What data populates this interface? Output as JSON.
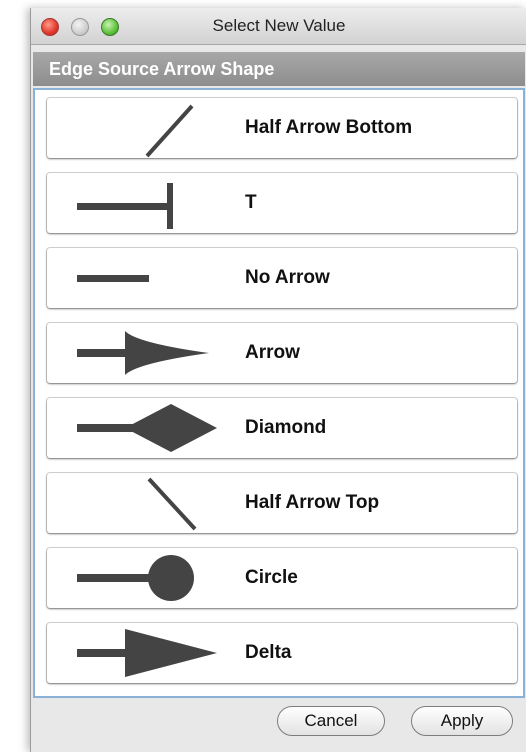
{
  "window": {
    "title": "Select New Value"
  },
  "panel": {
    "header": "Edge Source Arrow Shape"
  },
  "items": [
    {
      "label": "Half Arrow Bottom",
      "icon": "half-arrow-bottom-icon"
    },
    {
      "label": "T",
      "icon": "t-arrow-icon"
    },
    {
      "label": "No Arrow",
      "icon": "no-arrow-icon"
    },
    {
      "label": "Arrow",
      "icon": "arrow-icon"
    },
    {
      "label": "Diamond",
      "icon": "diamond-icon"
    },
    {
      "label": "Half Arrow Top",
      "icon": "half-arrow-top-icon"
    },
    {
      "label": "Circle",
      "icon": "circle-icon"
    },
    {
      "label": "Delta",
      "icon": "delta-icon"
    }
  ],
  "buttons": {
    "cancel": "Cancel",
    "apply": "Apply"
  },
  "colors": {
    "icon": "#444444",
    "list_border": "#8ab2d8",
    "header_bg": "#999999"
  }
}
